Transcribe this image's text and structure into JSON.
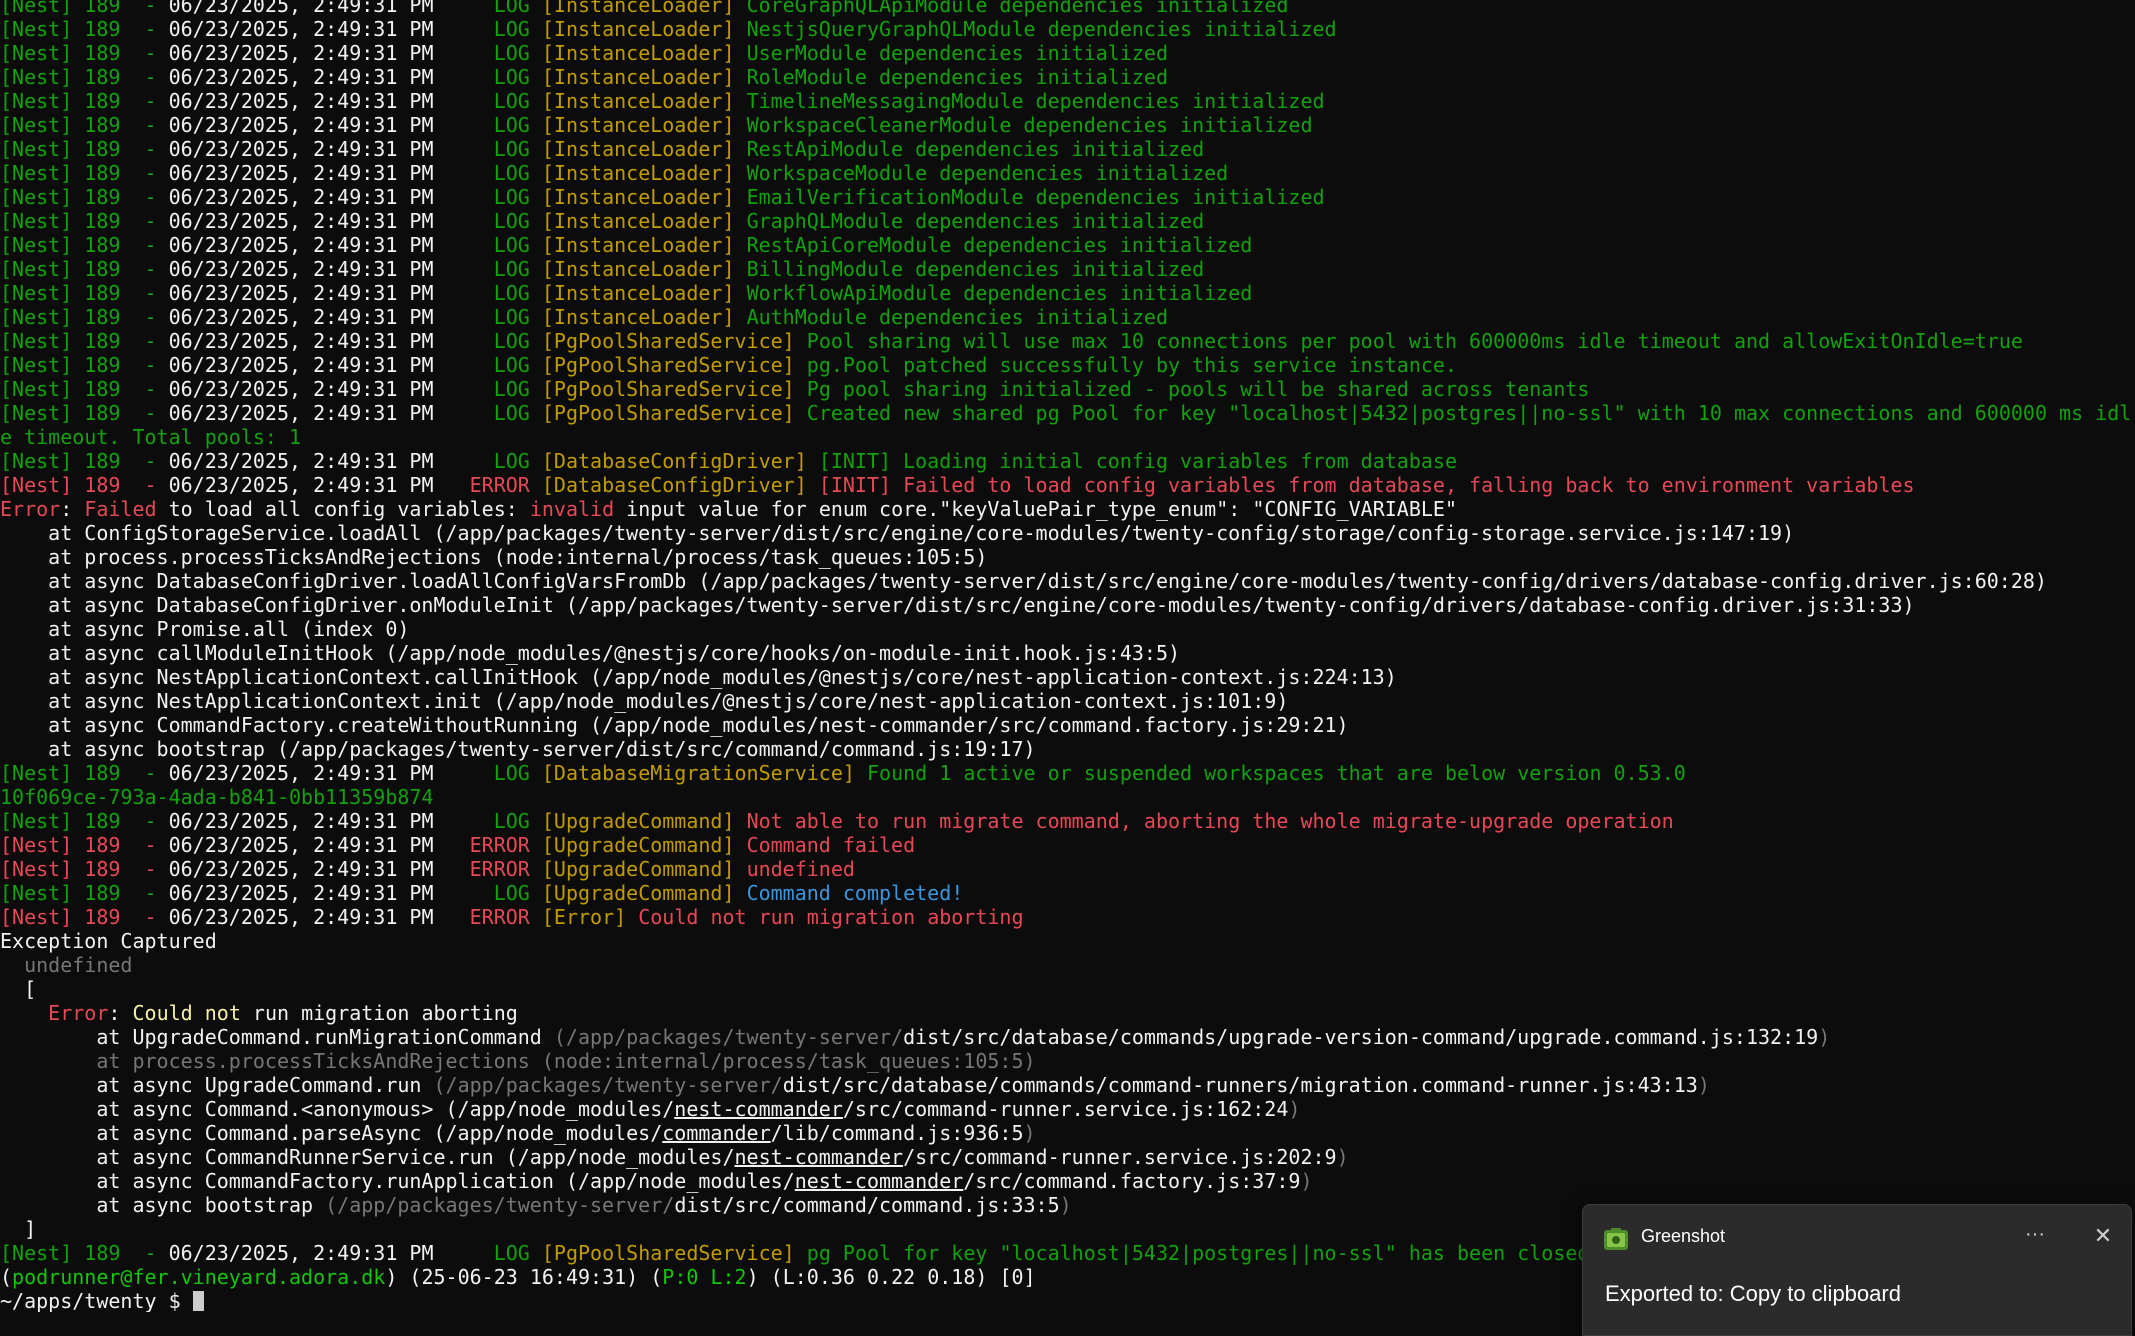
{
  "log_lines": [
    {
      "text": "[Nest] 189  - 06/23/2025, 2:49:31 PM     LOG [InstanceLoader] CoreGraphQLApiModule dependencies initialized"
    },
    {
      "text": "[Nest] 189  - 06/23/2025, 2:49:31 PM     LOG [InstanceLoader] NestjsQueryGraphQLModule dependencies initialized"
    },
    {
      "text": "[Nest] 189  - 06/23/2025, 2:49:31 PM     LOG [InstanceLoader] UserModule dependencies initialized"
    },
    {
      "text": "[Nest] 189  - 06/23/2025, 2:49:31 PM     LOG [InstanceLoader] RoleModule dependencies initialized"
    },
    {
      "text": "[Nest] 189  - 06/23/2025, 2:49:31 PM     LOG [InstanceLoader] TimelineMessagingModule dependencies initialized"
    },
    {
      "text": "[Nest] 189  - 06/23/2025, 2:49:31 PM     LOG [InstanceLoader] WorkspaceCleanerModule dependencies initialized"
    },
    {
      "text": "[Nest] 189  - 06/23/2025, 2:49:31 PM     LOG [InstanceLoader] RestApiModule dependencies initialized"
    },
    {
      "text": "[Nest] 189  - 06/23/2025, 2:49:31 PM     LOG [InstanceLoader] WorkspaceModule dependencies initialized"
    },
    {
      "text": "[Nest] 189  - 06/23/2025, 2:49:31 PM     LOG [InstanceLoader] EmailVerificationModule dependencies initialized"
    },
    {
      "text": "[Nest] 189  - 06/23/2025, 2:49:31 PM     LOG [InstanceLoader] GraphQLModule dependencies initialized"
    },
    {
      "text": "[Nest] 189  - 06/23/2025, 2:49:31 PM     LOG [InstanceLoader] RestApiCoreModule dependencies initialized"
    },
    {
      "text": "[Nest] 189  - 06/23/2025, 2:49:31 PM     LOG [InstanceLoader] BillingModule dependencies initialized"
    },
    {
      "text": "[Nest] 189  - 06/23/2025, 2:49:31 PM     LOG [InstanceLoader] WorkflowApiModule dependencies initialized"
    },
    {
      "text": "[Nest] 189  - 06/23/2025, 2:49:31 PM     LOG [InstanceLoader] AuthModule dependencies initialized"
    },
    {
      "text": "[Nest] 189  - 06/23/2025, 2:49:31 PM     LOG [PgPoolSharedService] Pool sharing will use max 10 connections per pool with 600000ms idle timeout and allowExitOnIdle=true"
    },
    {
      "text": "[Nest] 189  - 06/23/2025, 2:49:31 PM     LOG [PgPoolSharedService] pg.Pool patched successfully by this service instance."
    },
    {
      "text": "[Nest] 189  - 06/23/2025, 2:49:31 PM     LOG [PgPoolSharedService] Pg pool sharing initialized - pools will be shared across tenants"
    },
    {
      "text": "[Nest] 189  - 06/23/2025, 2:49:31 PM     LOG [PgPoolSharedService] Created new shared pg Pool for key \"localhost|5432|postgres||no-ssl\" with 10 max connections and 600000 ms idle timeout. Total pools: 1"
    },
    {
      "text": "[Nest] 189  - 06/23/2025, 2:49:31 PM     LOG [DatabaseConfigDriver] [INIT] Loading initial config variables from database"
    },
    {
      "text": "[Nest] 189  - 06/23/2025, 2:49:31 PM   ERROR [DatabaseConfigDriver] [INIT] Failed to load config variables from database, falling back to environment variables"
    },
    {
      "text": "Error: Failed to load all config variables: invalid input value for enum core.\"keyValuePair_type_enum\": \"CONFIG_VARIABLE\""
    },
    {
      "text": "    at ConfigStorageService.loadAll (/app/packages/twenty-server/dist/src/engine/core-modules/twenty-config/storage/config-storage.service.js:147:19)"
    },
    {
      "text": "    at process.processTicksAndRejections (node:internal/process/task_queues:105:5)"
    },
    {
      "text": "    at async DatabaseConfigDriver.loadAllConfigVarsFromDb (/app/packages/twenty-server/dist/src/engine/core-modules/twenty-config/drivers/database-config.driver.js:60:28)"
    },
    {
      "text": "    at async DatabaseConfigDriver.onModuleInit (/app/packages/twenty-server/dist/src/engine/core-modules/twenty-config/drivers/database-config.driver.js:31:33)"
    },
    {
      "text": "    at async Promise.all (index 0)"
    },
    {
      "text": "    at async callModuleInitHook (/app/node_modules/@nestjs/core/hooks/on-module-init.hook.js:43:5)"
    },
    {
      "text": "    at async NestApplicationContext.callInitHook (/app/node_modules/@nestjs/core/nest-application-context.js:224:13)"
    },
    {
      "text": "    at async NestApplicationContext.init (/app/node_modules/@nestjs/core/nest-application-context.js:101:9)"
    },
    {
      "text": "    at async CommandFactory.createWithoutRunning (/app/node_modules/nest-commander/src/command.factory.js:29:21)"
    },
    {
      "text": "    at async bootstrap (/app/packages/twenty-server/dist/src/command/command.js:19:17)"
    },
    {
      "text": "[Nest] 189  - 06/23/2025, 2:49:31 PM     LOG [DatabaseMigrationService] Found 1 active or suspended workspaces that are below version 0.53.0"
    },
    {
      "text": "10f069ce-793a-4ada-b841-0bb11359b874"
    },
    {
      "text": "[Nest] 189  - 06/23/2025, 2:49:31 PM     LOG [UpgradeCommand] Not able to run migrate command, aborting the whole migrate-upgrade operation"
    },
    {
      "text": "[Nest] 189  - 06/23/2025, 2:49:31 PM   ERROR [UpgradeCommand] Command failed"
    },
    {
      "text": "[Nest] 189  - 06/23/2025, 2:49:31 PM   ERROR [UpgradeCommand] undefined"
    },
    {
      "text": "[Nest] 189  - 06/23/2025, 2:49:31 PM     LOG [UpgradeCommand] Command completed!"
    },
    {
      "text": "[Nest] 189  - 06/23/2025, 2:49:31 PM   ERROR [Error] Could not run migration aborting"
    },
    {
      "text": "Exception Captured"
    },
    {
      "text": "  undefined"
    },
    {
      "text": "  ["
    },
    {
      "text": "    Error: Could not run migration aborting"
    },
    {
      "text": "        at UpgradeCommand.runMigrationCommand (/app/packages/twenty-server/dist/src/database/commands/upgrade-version-command/upgrade.command.js:132:19)"
    },
    {
      "text": "        at process.processTicksAndRejections (node:internal/process/task_queues:105:5)"
    },
    {
      "text": "        at async UpgradeCommand.run (/app/packages/twenty-server/dist/src/database/commands/command-runners/migration.command-runner.js:43:13)"
    },
    {
      "text": "        at async Command.<anonymous> (/app/node_modules/nest-commander/src/command-runner.service.js:162:24)"
    },
    {
      "text": "        at async Command.parseAsync (/app/node_modules/commander/lib/command.js:936:5)"
    },
    {
      "text": "        at async CommandRunnerService.run (/app/node_modules/nest-commander/src/command-runner.service.js:202:9)"
    },
    {
      "text": "        at async CommandFactory.runApplication (/app/node_modules/nest-commander/src/command.factory.js:37:9)"
    },
    {
      "text": "        at async bootstrap (/app/packages/twenty-server/dist/src/command/command.js:33:5)"
    },
    {
      "text": "  ]"
    },
    {
      "text": "[Nest] 189  - 06/23/2025, 2:49:31 PM     LOG [PgPoolSharedService] pg Pool for key \"localhost|5432|postgres||no-ssl\" has been closed"
    },
    {
      "text": "(podrunner@fer.vineyard.adora.dk) (25-06-23 16:49:31) (P:0 L:2) (L:0.36 0.22 0.18) [0]"
    },
    {
      "text": "~/apps/twenty $ "
    }
  ],
  "toast": {
    "app_name": "Greenshot",
    "more_glyph": "···",
    "close_glyph": "✕",
    "message": "Exported to: Copy to clipboard",
    "icon": "greenshot-app-icon"
  },
  "colors": {
    "terminal_bg": "#0c0c0c",
    "nest_green": "#13a10e",
    "error_red": "#e74856",
    "context_yellow": "#c19c00",
    "completed_cyan": "#3a96dd",
    "dim_gray": "#767676",
    "toast_bg": "#2b2b2b"
  }
}
